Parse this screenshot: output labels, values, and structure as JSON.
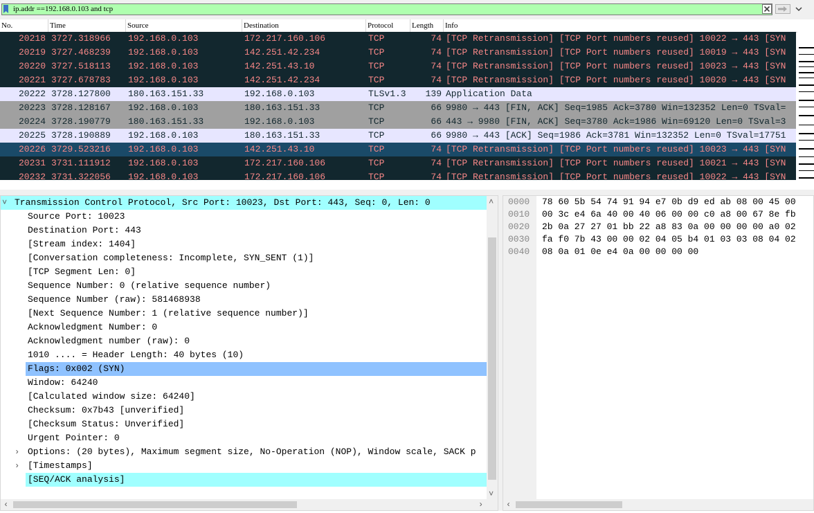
{
  "filter": {
    "value": "ip.addr ==192.168.0.103 and tcp"
  },
  "columns": [
    "No.",
    "Time",
    "Source",
    "Destination",
    "Protocol",
    "Length",
    "Info"
  ],
  "packets": [
    {
      "no": "20218",
      "time": "3727.318966",
      "src": "192.168.0.103",
      "dst": "172.217.160.106",
      "proto": "TCP",
      "len": "74",
      "info": "[TCP Retransmission] [TCP Port numbers reused] 10022 → 443 [SYN",
      "style": "red"
    },
    {
      "no": "20219",
      "time": "3727.468239",
      "src": "192.168.0.103",
      "dst": "142.251.42.234",
      "proto": "TCP",
      "len": "74",
      "info": "[TCP Retransmission] [TCP Port numbers reused] 10019 → 443 [SYN",
      "style": "red"
    },
    {
      "no": "20220",
      "time": "3727.518113",
      "src": "192.168.0.103",
      "dst": "142.251.43.10",
      "proto": "TCP",
      "len": "74",
      "info": "[TCP Retransmission] [TCP Port numbers reused] 10023 → 443 [SYN",
      "style": "red"
    },
    {
      "no": "20221",
      "time": "3727.678783",
      "src": "192.168.0.103",
      "dst": "142.251.42.234",
      "proto": "TCP",
      "len": "74",
      "info": "[TCP Retransmission] [TCP Port numbers reused] 10020 → 443 [SYN",
      "style": "red"
    },
    {
      "no": "20222",
      "time": "3728.127800",
      "src": "180.163.151.33",
      "dst": "192.168.0.103",
      "proto": "TLSv1.3",
      "len": "139",
      "info": "Application Data",
      "style": "lav"
    },
    {
      "no": "20223",
      "time": "3728.128167",
      "src": "192.168.0.103",
      "dst": "180.163.151.33",
      "proto": "TCP",
      "len": "66",
      "info": "9980 → 443 [FIN, ACK] Seq=1985 Ack=3780 Win=132352 Len=0 TSval=",
      "style": "gray"
    },
    {
      "no": "20224",
      "time": "3728.190779",
      "src": "180.163.151.33",
      "dst": "192.168.0.103",
      "proto": "TCP",
      "len": "66",
      "info": "443 → 9980 [FIN, ACK] Seq=3780 Ack=1986 Win=69120 Len=0 TSval=3",
      "style": "gray"
    },
    {
      "no": "20225",
      "time": "3728.190889",
      "src": "192.168.0.103",
      "dst": "180.163.151.33",
      "proto": "TCP",
      "len": "66",
      "info": "9980 → 443 [ACK] Seq=1986 Ack=3781 Win=132352 Len=0 TSval=17751",
      "style": "lav"
    },
    {
      "no": "20226",
      "time": "3729.523216",
      "src": "192.168.0.103",
      "dst": "142.251.43.10",
      "proto": "TCP",
      "len": "74",
      "info": "[TCP Retransmission] [TCP Port numbers reused] 10023 → 443 [SYN",
      "style": "sel"
    },
    {
      "no": "20231",
      "time": "3731.111912",
      "src": "192.168.0.103",
      "dst": "172.217.160.106",
      "proto": "TCP",
      "len": "74",
      "info": "[TCP Retransmission] [TCP Port numbers reused] 10021 → 443 [SYN",
      "style": "red"
    },
    {
      "no": "20232",
      "time": "3731.322056",
      "src": "192.168.0.103",
      "dst": "172.217.160.106",
      "proto": "TCP",
      "len": "74",
      "info": "[TCP Retransmission] [TCP Port numbers reused] 10022 → 443 [SYN",
      "style": "red"
    }
  ],
  "detail": [
    {
      "text": "Transmission Control Protocol, Src Port: 10023, Dst Port: 443, Seq: 0, Len: 0",
      "level": 0,
      "expander": "expanded",
      "style": "top"
    },
    {
      "text": "Source Port: 10023",
      "level": 1
    },
    {
      "text": "Destination Port: 443",
      "level": 1
    },
    {
      "text": "[Stream index: 1404]",
      "level": 1
    },
    {
      "text": "[Conversation completeness: Incomplete, SYN_SENT (1)]",
      "level": 1
    },
    {
      "text": "[TCP Segment Len: 0]",
      "level": 1
    },
    {
      "text": "Sequence Number: 0    (relative sequence number)",
      "level": 1
    },
    {
      "text": "Sequence Number (raw): 581468938",
      "level": 1
    },
    {
      "text": "[Next Sequence Number: 1    (relative sequence number)]",
      "level": 1
    },
    {
      "text": "Acknowledgment Number: 0",
      "level": 1
    },
    {
      "text": "Acknowledgment number (raw): 0",
      "level": 1
    },
    {
      "text": "1010 .... = Header Length: 40 bytes (10)",
      "level": 1
    },
    {
      "text": "Flags: 0x002 (SYN)",
      "level": 1,
      "expander": "collapsed",
      "style": "sel"
    },
    {
      "text": "Window: 64240",
      "level": 1
    },
    {
      "text": "[Calculated window size: 64240]",
      "level": 1
    },
    {
      "text": "Checksum: 0x7b43 [unverified]",
      "level": 1
    },
    {
      "text": "[Checksum Status: Unverified]",
      "level": 1
    },
    {
      "text": "Urgent Pointer: 0",
      "level": 1
    },
    {
      "text": "Options: (20 bytes), Maximum segment size, No-Operation (NOP), Window scale, SACK p",
      "level": 1,
      "expander": "collapsed"
    },
    {
      "text": "[Timestamps]",
      "level": 1,
      "expander": "collapsed"
    },
    {
      "text": "[SEQ/ACK analysis]",
      "level": 1,
      "expander": "collapsed",
      "style": "cyan"
    }
  ],
  "bytes": [
    {
      "offset": "0000",
      "hex": "78 60 5b 54 74 91 94 e7  0b d9 ed ab 08 00 45 00"
    },
    {
      "offset": "0010",
      "hex": "00 3c e4 6a 40 00 40 06  00 00 c0 a8 00 67 8e fb"
    },
    {
      "offset": "0020",
      "hex": "2b 0a 27 27 01 bb 22 a8  83 0a 00 00 00 00 a0 02"
    },
    {
      "offset": "0030",
      "hex": "fa f0 7b 43 00 00 02 04  05 b4 01 03 03 08 04 02"
    },
    {
      "offset": "0040",
      "hex": "08 0a 01 0e e4 0a 00 00  00 00"
    }
  ],
  "icons": {
    "bookmark": "bookmark-icon",
    "clear": "clear-icon",
    "apply": "apply-arrow-icon",
    "dropdown": "chevron-down-icon",
    "expanded": "chevron-down-icon",
    "collapsed": "chevron-right-icon"
  },
  "colors": {
    "filter_valid": "#afffaf",
    "row_red_bg": "#12272e",
    "row_red_fg": "#f78787",
    "row_lav_bg": "#e7e6ff",
    "row_gray_bg": "#a0a0a0",
    "row_selected_bg": "#1a4a68",
    "detail_highlight": "#a0ffff",
    "detail_selected": "#8fc2ff"
  }
}
